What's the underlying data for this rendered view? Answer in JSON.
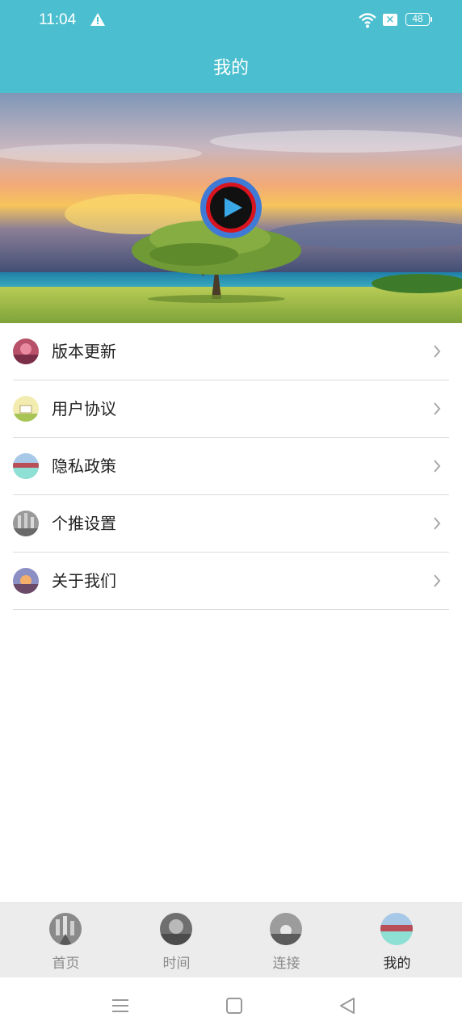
{
  "status_bar": {
    "time": "11:04",
    "battery": "48"
  },
  "header": {
    "title": "我的"
  },
  "menu": {
    "items": [
      {
        "label": "版本更新"
      },
      {
        "label": "用户协议"
      },
      {
        "label": "隐私政策"
      },
      {
        "label": "个推设置"
      },
      {
        "label": "关于我们"
      }
    ]
  },
  "tabbar": {
    "tabs": [
      {
        "label": "首页",
        "active": false
      },
      {
        "label": "时间",
        "active": false
      },
      {
        "label": "连接",
        "active": false
      },
      {
        "label": "我的",
        "active": true
      }
    ]
  },
  "colors": {
    "accent": "#4bbfcf",
    "tabbar_bg": "#ececec",
    "divider": "#dcdcdc"
  },
  "icons": [
    "warning-icon",
    "wifi-icon",
    "sim-icon",
    "battery-icon",
    "play-icon",
    "chevron-right-icon",
    "menu-nav-icon",
    "home-nav-icon",
    "back-nav-icon"
  ]
}
